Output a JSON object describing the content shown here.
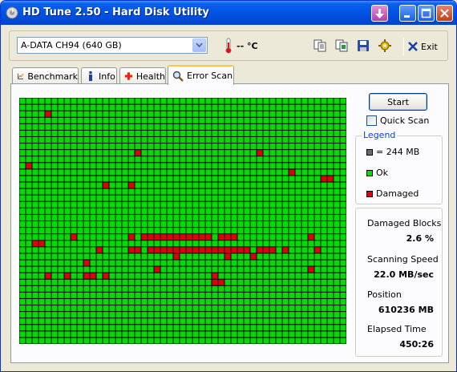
{
  "window": {
    "title": "HD Tune 2.50 - Hard Disk Utility"
  },
  "toolbar": {
    "drive": "A-DATA  CH94 (640 GB)",
    "temperature": "-- °C",
    "exit_label": "Exit",
    "icons": [
      "copy-info-icon",
      "copy-screenshot-icon",
      "save-icon",
      "options-icon",
      "exit-icon"
    ]
  },
  "tabs": [
    {
      "label": "Benchmark",
      "icon": "benchmark-icon",
      "active": false
    },
    {
      "label": "Info",
      "icon": "info-icon",
      "active": false
    },
    {
      "label": "Health",
      "icon": "health-icon",
      "active": false
    },
    {
      "label": "Error Scan",
      "icon": "magnifier-icon",
      "active": true
    }
  ],
  "error_scan": {
    "start_label": "Start",
    "quick_scan_label": "Quick Scan",
    "quick_scan_checked": false,
    "legend": {
      "title": "Legend",
      "block_size": "= 244 MB",
      "ok_label": "Ok",
      "damaged_label": "Damaged"
    },
    "stats": {
      "damaged_blocks_label": "Damaged Blocks",
      "damaged_blocks_value": "2.6 %",
      "scanning_speed_label": "Scanning Speed",
      "scanning_speed_value": "22.0 MB/sec",
      "position_label": "Position",
      "position_value": "610236 MB",
      "elapsed_time_label": "Elapsed Time",
      "elapsed_time_value": "450:26"
    },
    "grid": {
      "columns": 51,
      "rows": 38,
      "ok_color": "#00dd00",
      "damaged_color": "#dd0011",
      "line_color": "#000000",
      "damaged_cells": [
        [
          4,
          2
        ],
        [
          18,
          8
        ],
        [
          37,
          8
        ],
        [
          1,
          10
        ],
        [
          42,
          11
        ],
        [
          47,
          12
        ],
        [
          48,
          12
        ],
        [
          13,
          13
        ],
        [
          17,
          13
        ],
        [
          2,
          22
        ],
        [
          3,
          22
        ],
        [
          8,
          21
        ],
        [
          12,
          23
        ],
        [
          17,
          21
        ],
        [
          45,
          21
        ],
        [
          17,
          23
        ],
        [
          18,
          23
        ],
        [
          22,
          23
        ],
        [
          26,
          23
        ],
        [
          28,
          23
        ],
        [
          29,
          23
        ],
        [
          30,
          23
        ],
        [
          31,
          23
        ],
        [
          35,
          23
        ],
        [
          37,
          23
        ],
        [
          38,
          23
        ],
        [
          39,
          23
        ],
        [
          41,
          23
        ],
        [
          46,
          23
        ],
        [
          19,
          21
        ],
        [
          20,
          21
        ],
        [
          21,
          21
        ],
        [
          22,
          21
        ],
        [
          23,
          21
        ],
        [
          24,
          21
        ],
        [
          25,
          21
        ],
        [
          26,
          21
        ],
        [
          27,
          21
        ],
        [
          28,
          21
        ],
        [
          29,
          21
        ],
        [
          31,
          21
        ],
        [
          32,
          21
        ],
        [
          33,
          21
        ],
        [
          20,
          23
        ],
        [
          21,
          23
        ],
        [
          23,
          23
        ],
        [
          24,
          23
        ],
        [
          25,
          23
        ],
        [
          27,
          23
        ],
        [
          32,
          23
        ],
        [
          33,
          23
        ],
        [
          34,
          23
        ],
        [
          24,
          24
        ],
        [
          32,
          24
        ],
        [
          36,
          24
        ],
        [
          10,
          25
        ],
        [
          21,
          26
        ],
        [
          45,
          26
        ],
        [
          4,
          27
        ],
        [
          7,
          27
        ],
        [
          10,
          27
        ],
        [
          11,
          27
        ],
        [
          13,
          27
        ],
        [
          30,
          27
        ],
        [
          30,
          28
        ],
        [
          31,
          28
        ]
      ]
    }
  }
}
